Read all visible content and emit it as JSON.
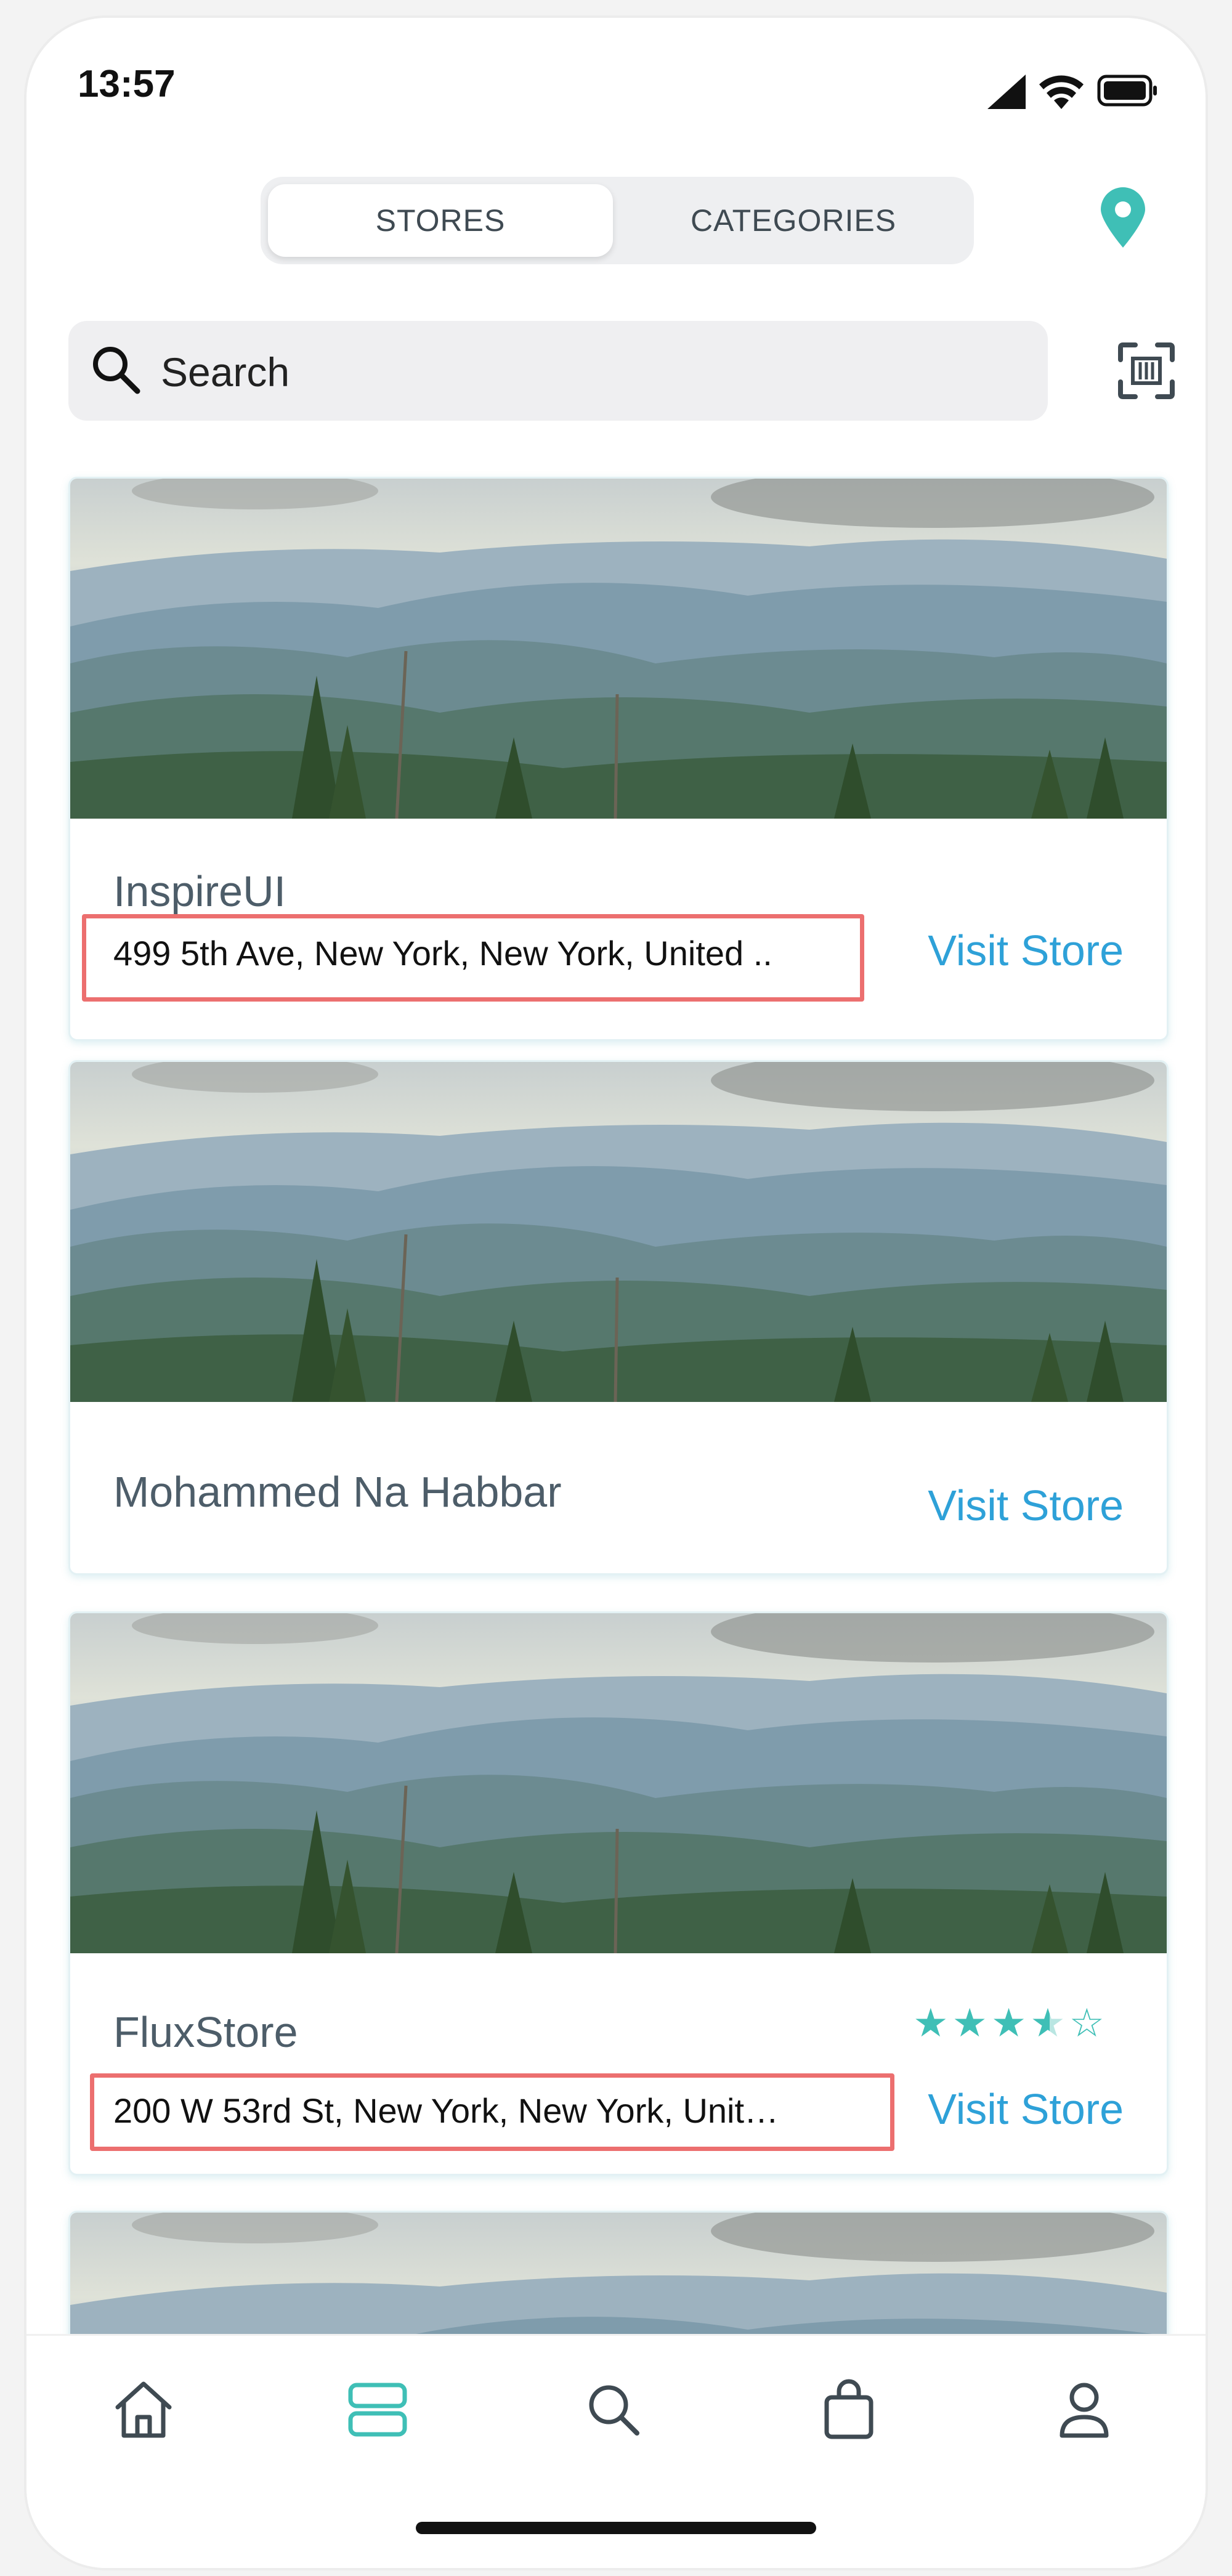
{
  "status_bar": {
    "time": "13:57"
  },
  "segmented": {
    "stores_label": "STORES",
    "categories_label": "CATEGORIES",
    "active": "stores"
  },
  "search": {
    "placeholder": "Search"
  },
  "stores": [
    {
      "name": "InspireUI",
      "address": "499 5th Ave, New York, New York, United ..",
      "visit_label": "Visit Store",
      "highlighted": true
    },
    {
      "name": "Mohammed Na Habbar",
      "address": "",
      "visit_label": "Visit Store",
      "highlighted": false
    },
    {
      "name": "FluxStore",
      "address": "200 W 53rd St, New York, New York, Unit…",
      "visit_label": "Visit Store",
      "rating": 3.5,
      "rating_max": 5,
      "highlighted": true
    }
  ],
  "colors": {
    "accent": "#3fbfb6",
    "link": "#2ea1d8",
    "highlight": "#ec6f6f"
  },
  "bottom_nav": [
    {
      "name": "home",
      "icon": "home-icon"
    },
    {
      "name": "stores",
      "icon": "stores-icon",
      "active": true
    },
    {
      "name": "search",
      "icon": "search-icon"
    },
    {
      "name": "cart",
      "icon": "bag-icon"
    },
    {
      "name": "profile",
      "icon": "user-icon"
    }
  ]
}
